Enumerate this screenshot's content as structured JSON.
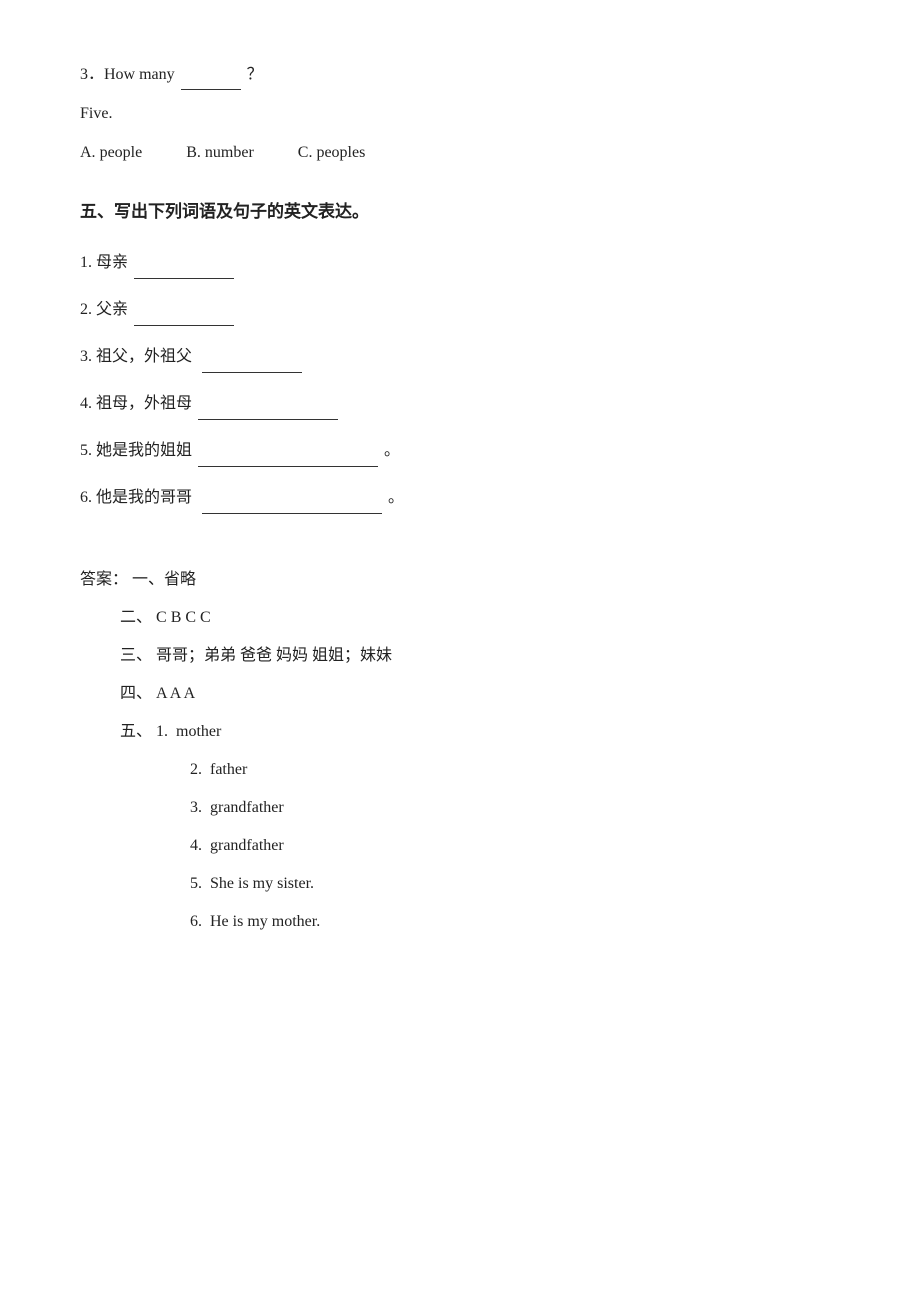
{
  "question3": {
    "text": "3．How many",
    "blank": "______",
    "end": "？",
    "answer_line": "Five.",
    "options": [
      {
        "label": "A.",
        "value": "people"
      },
      {
        "label": "B.",
        "value": "number"
      },
      {
        "label": "C.",
        "value": "peoples"
      }
    ]
  },
  "section5": {
    "title": "五、写出下列词语及句子的英文表达。",
    "items": [
      {
        "num": "1.",
        "text": "母亲",
        "underline_class": "underline underline-medium"
      },
      {
        "num": "2.",
        "text": "父亲",
        "underline_class": "underline underline-medium"
      },
      {
        "num": "3.",
        "text": "祖父，外祖父",
        "underline_class": "underline underline-medium"
      },
      {
        "num": "4.",
        "text": "祖母，外祖母",
        "underline_class": "underline underline-long"
      },
      {
        "num": "5.",
        "text": "她是我的姐姐",
        "underline_class": "underline underline-xl",
        "suffix": "。"
      },
      {
        "num": "6.",
        "text": "他是我的哥哥",
        "underline_class": "underline underline-xl",
        "suffix": "。"
      }
    ]
  },
  "answers": {
    "label": "答案：",
    "section1": "一、省略",
    "section2_label": "二、",
    "section2_values": "C  B   C  C",
    "section3_label": "三、",
    "section3_values": "哥哥；弟弟    爸爸    妈妈   姐姐；妹妹",
    "section4_label": "四、",
    "section4_values": "A   A   A",
    "section5_label": "五、",
    "section5_items": [
      {
        "num": "1.",
        "value": "mother"
      },
      {
        "num": "2.",
        "value": "father"
      },
      {
        "num": "3.",
        "value": "grandfather"
      },
      {
        "num": "4.",
        "value": "grandfather"
      },
      {
        "num": "5.",
        "value": "She is my sister."
      },
      {
        "num": "6.",
        "value": "He is my mother."
      }
    ]
  }
}
